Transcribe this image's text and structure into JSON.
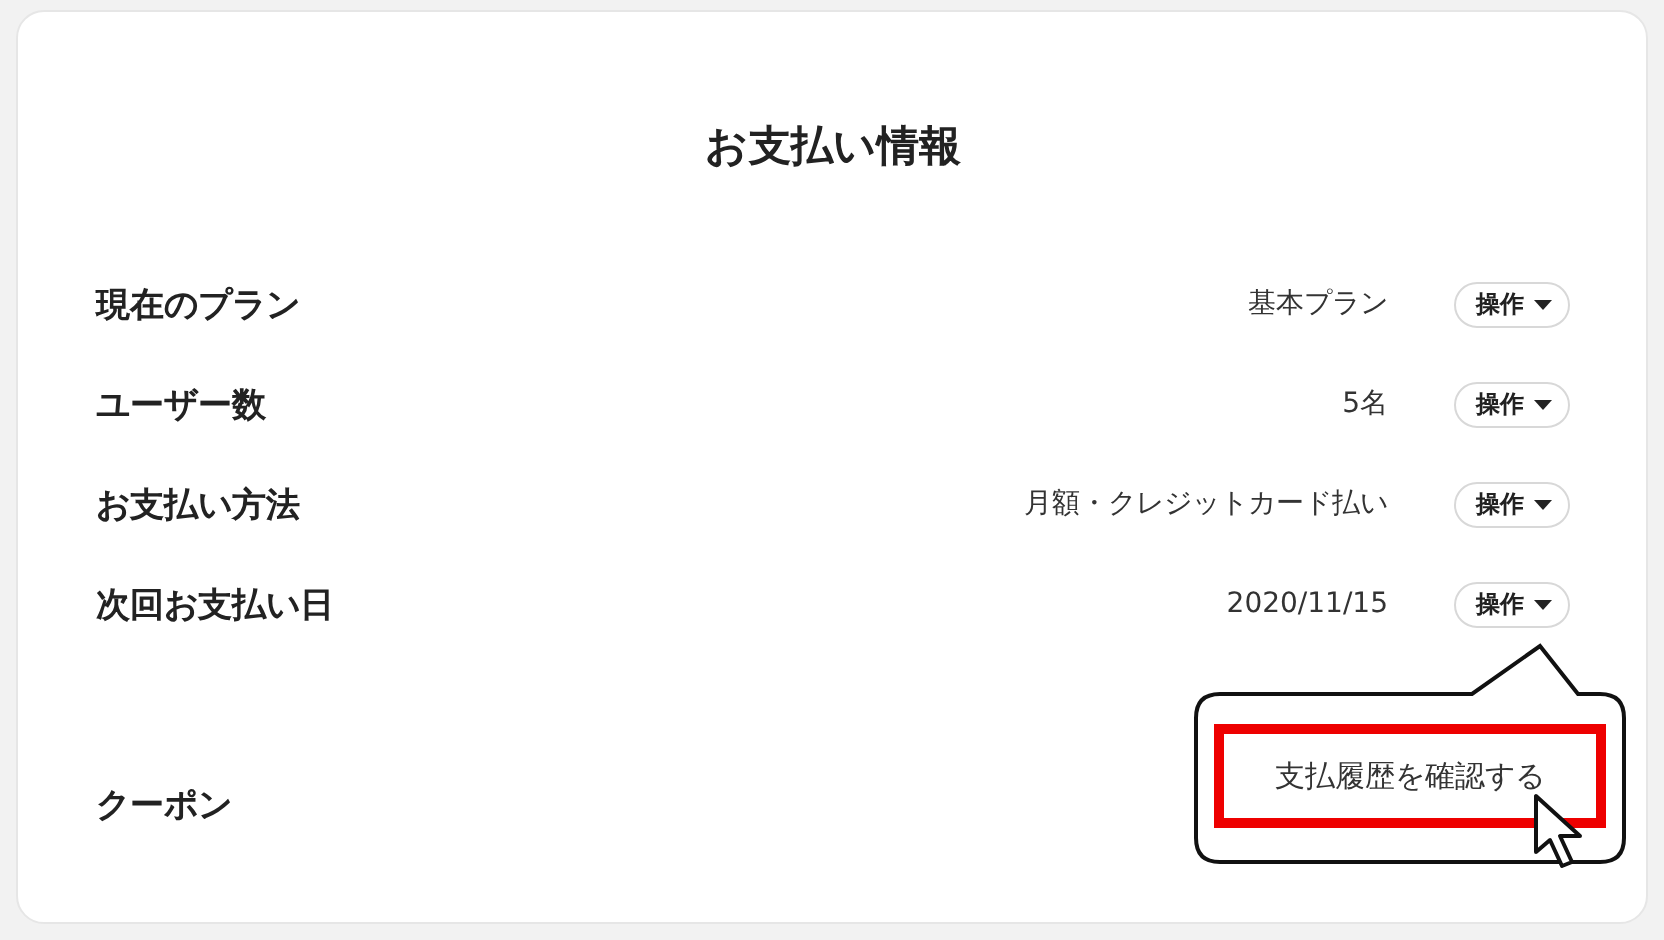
{
  "title": "お支払い情報",
  "rows": [
    {
      "label": "現在のプラン",
      "value": "基本プラン",
      "action": "操作"
    },
    {
      "label": "ユーザー数",
      "value": "5名",
      "action": "操作"
    },
    {
      "label": "お支払い方法",
      "value": "月額・クレジットカード払い",
      "action": "操作"
    },
    {
      "label": "次回お支払い日",
      "value": "2020/11/15",
      "action": "操作"
    }
  ],
  "coupon": {
    "label": "クーポン"
  },
  "popup": {
    "item": "支払履歴を確認する"
  }
}
